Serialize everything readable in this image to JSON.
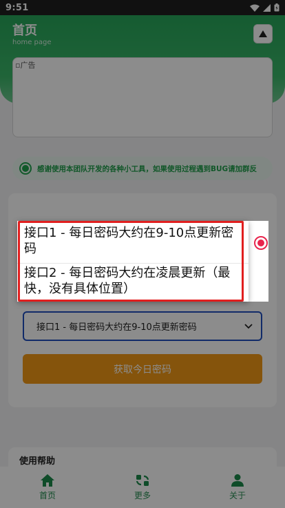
{
  "status_bar": {
    "time": "9:51"
  },
  "header": {
    "title": "首页",
    "subtitle": "home page"
  },
  "ad": {
    "alt_text": "广告"
  },
  "notice": {
    "text": "感谢使用本团队开发的各种小工具，如果使用过程遇到BUG请加群反"
  },
  "select": {
    "selected_label": "接口1 - 每日密码大约在9-10点更新密码"
  },
  "get_button": {
    "label": "获取今日密码"
  },
  "help": {
    "title": "使用帮助"
  },
  "dropdown": {
    "options": [
      {
        "label": "接口1 - 每日密码大约在9-10点更新密码",
        "selected": true
      },
      {
        "label": "接口2 - 每日密码大约在凌晨更新（最快，没有具体位置）",
        "selected": false
      }
    ]
  },
  "tabbar": {
    "items": [
      {
        "label": "首页",
        "icon": "home-icon"
      },
      {
        "label": "更多",
        "icon": "more-icon"
      },
      {
        "label": "关于",
        "icon": "user-icon"
      }
    ]
  },
  "colors": {
    "green": "#27a65a",
    "orange": "#f39a17",
    "select_border": "#1f4fbf",
    "highlight": "#e11f1f",
    "radio": "#e8244c"
  }
}
